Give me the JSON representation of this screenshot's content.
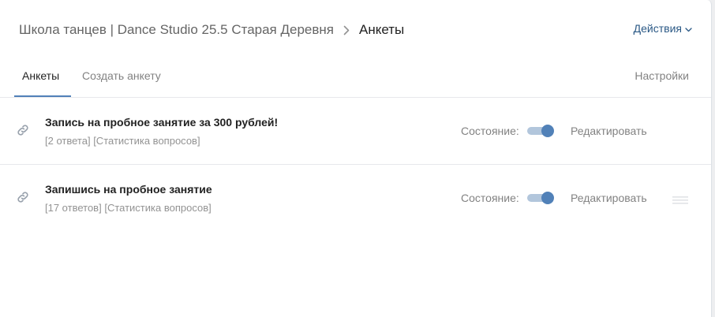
{
  "breadcrumb": {
    "root": "Школа танцев | Dance Studio 25.5 Старая Деревня",
    "current": "Анкеты"
  },
  "header": {
    "actions_label": "Действия"
  },
  "tabs": [
    {
      "label": "Анкеты",
      "active": true
    },
    {
      "label": "Создать анкету",
      "active": false
    }
  ],
  "settings_label": "Настройки",
  "state_label": "Состояние:",
  "edit_label": "Редактировать",
  "forms": [
    {
      "title": "Запись на пробное занятие за 300 рублей!",
      "answers": "[2 ответа]",
      "stats": "[Статистика вопросов]",
      "enabled": true
    },
    {
      "title": "Запишись на пробное занятие",
      "answers": "[17 ответов]",
      "stats": "[Статистика вопросов]",
      "enabled": true
    }
  ],
  "colors": {
    "accent": "#5181b8",
    "link": "#2a5885",
    "toggle_track": "#b2c6dc"
  }
}
